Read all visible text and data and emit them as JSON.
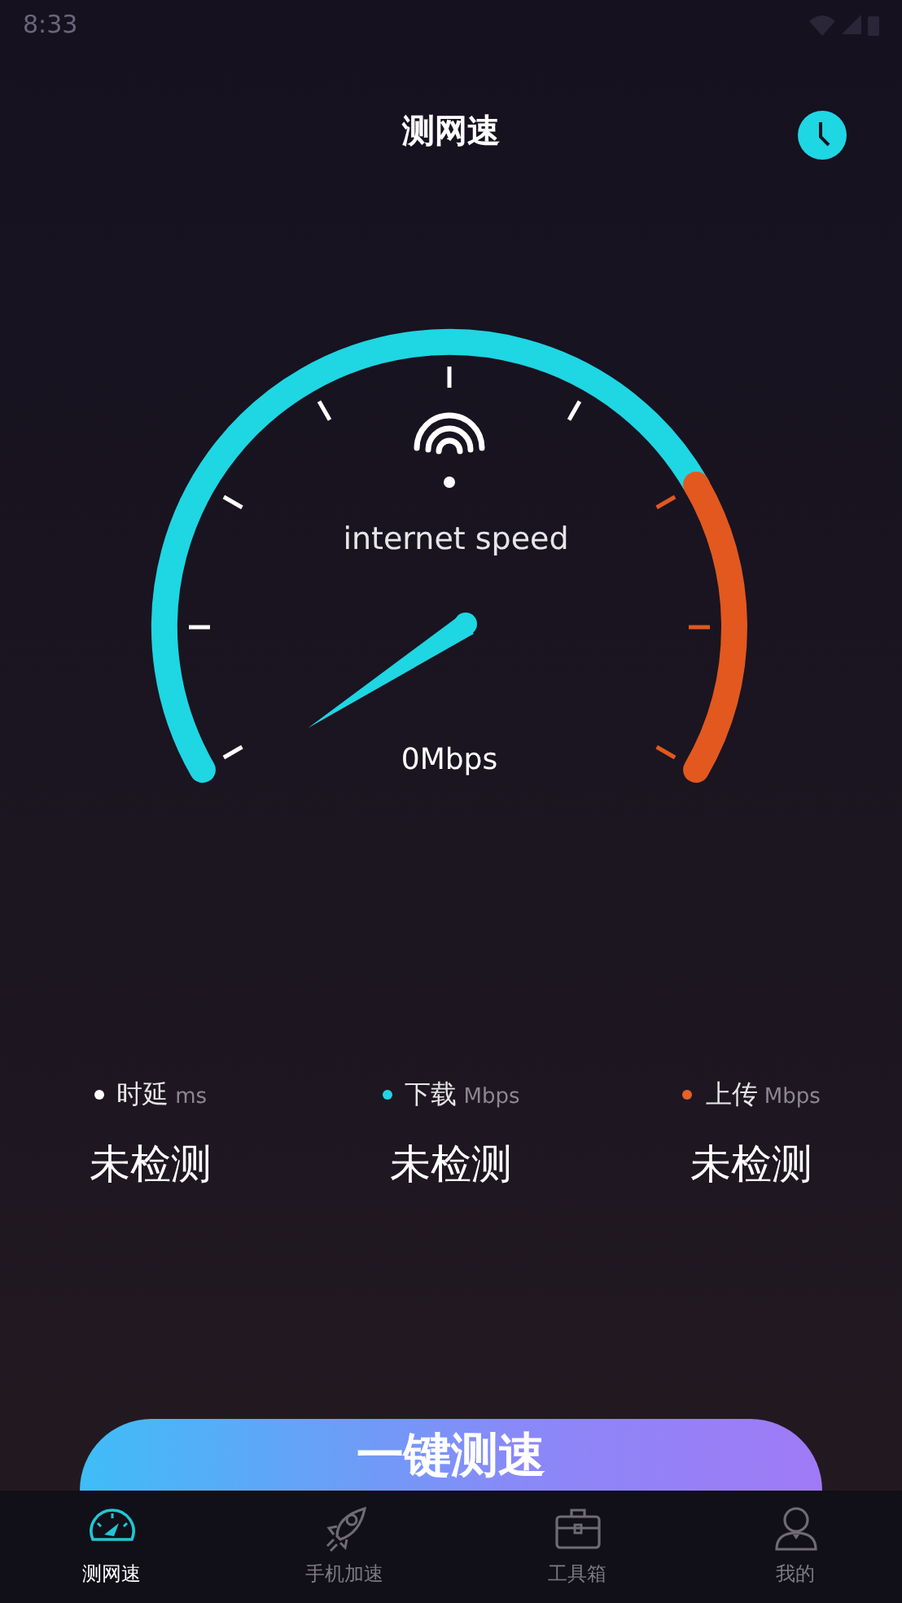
{
  "status_bar": {
    "time": "8:33"
  },
  "header": {
    "title": "测网速"
  },
  "gauge": {
    "label": "internet speed",
    "reading": "0Mbps"
  },
  "stats": [
    {
      "label": "时延",
      "unit": "ms",
      "value": "未检测",
      "color": "#ffffff"
    },
    {
      "label": "下载",
      "unit": "Mbps",
      "value": "未检测",
      "color": "#1fd6e3"
    },
    {
      "label": "上传",
      "unit": "Mbps",
      "value": "未检测",
      "color": "#e8602a"
    }
  ],
  "start_button": {
    "label": "一键测速"
  },
  "tabs": [
    {
      "label": "测网速",
      "kind": "speedometer",
      "selected": true
    },
    {
      "label": "手机加速",
      "kind": "rocket",
      "selected": false
    },
    {
      "label": "工具箱",
      "kind": "toolbox",
      "selected": false
    },
    {
      "label": "我的",
      "kind": "profile",
      "selected": false
    }
  ]
}
